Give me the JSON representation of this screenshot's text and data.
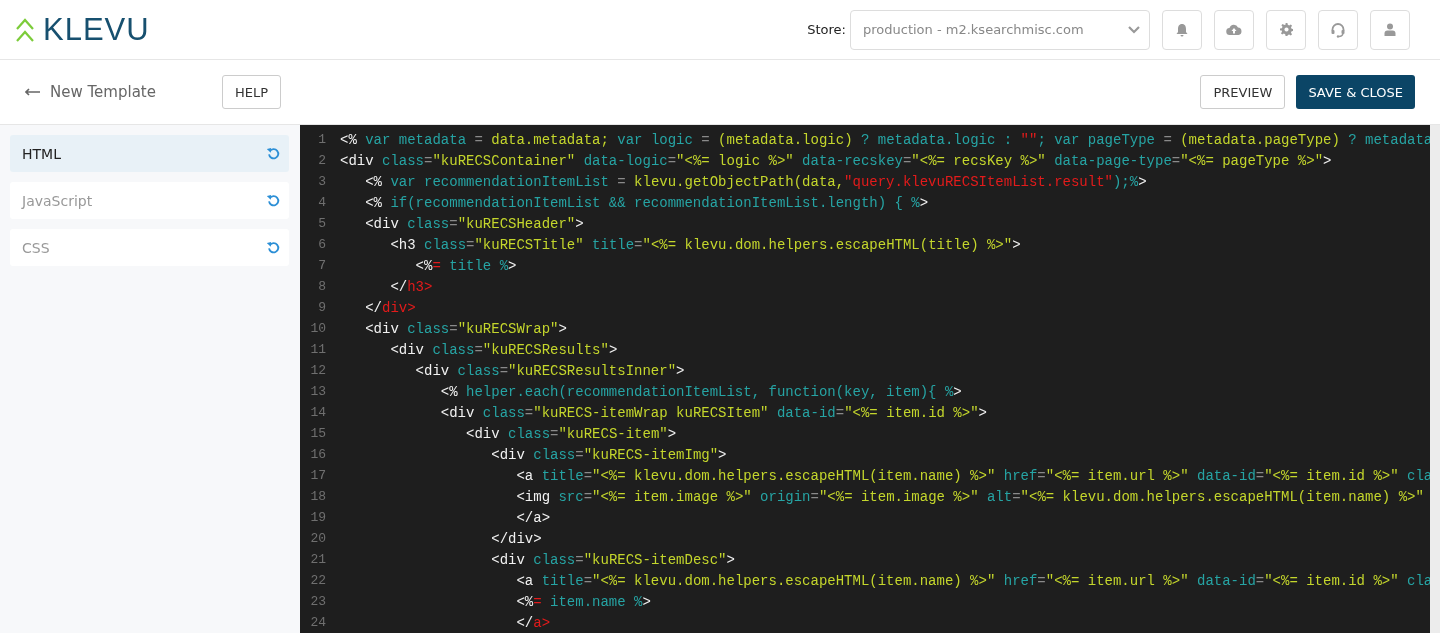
{
  "logo": {
    "text": "KLEVU"
  },
  "store": {
    "label": "Store:",
    "value": "production - m2.ksearchmisc.com"
  },
  "toolbar": {
    "back_label": "New Template",
    "help": "HELP",
    "preview": "PREVIEW",
    "save": "SAVE & CLOSE"
  },
  "sidebar": {
    "items": [
      {
        "label": "HTML",
        "selected": true
      },
      {
        "label": "JavaScript",
        "selected": false
      },
      {
        "label": "CSS",
        "selected": false
      }
    ]
  },
  "editor": {
    "lines": [
      {
        "number": "1",
        "tokens": [
          {
            "kind": "tag",
            "text": "<%"
          },
          {
            "kind": "attr",
            "text": " var metadata "
          },
          {
            "kind": "op",
            "text": "="
          },
          {
            "kind": "str",
            "text": " data.metadata;"
          },
          {
            "kind": "attr",
            "text": " var logic "
          },
          {
            "kind": "op",
            "text": "="
          },
          {
            "kind": "str",
            "text": " (metadata.logic)"
          },
          {
            "kind": "attr",
            "text": " ? metadata.logic : "
          },
          {
            "kind": "err",
            "text": "\"\""
          },
          {
            "kind": "attr",
            "text": "; var pageType "
          },
          {
            "kind": "op",
            "text": "="
          },
          {
            "kind": "str",
            "text": " (metadata.pageType)"
          },
          {
            "kind": "attr",
            "text": " ? metadata"
          }
        ]
      },
      {
        "number": "2",
        "tokens": [
          {
            "kind": "tag",
            "text": "<div"
          },
          {
            "kind": "attr",
            "text": " class"
          },
          {
            "kind": "op",
            "text": "="
          },
          {
            "kind": "str",
            "text": "\"kuRECSContainer\""
          },
          {
            "kind": "attr",
            "text": " data-logic"
          },
          {
            "kind": "op",
            "text": "="
          },
          {
            "kind": "str",
            "text": "\"<%= logic %>\""
          },
          {
            "kind": "attr",
            "text": " data-recskey"
          },
          {
            "kind": "op",
            "text": "="
          },
          {
            "kind": "str",
            "text": "\"<%= recsKey %>\""
          },
          {
            "kind": "attr",
            "text": " data-page-type"
          },
          {
            "kind": "op",
            "text": "="
          },
          {
            "kind": "str",
            "text": "\"<%= pageType %>\""
          },
          {
            "kind": "tag",
            "text": ">"
          }
        ]
      },
      {
        "number": "3",
        "tokens": [
          {
            "kind": "tag",
            "text": "   <%"
          },
          {
            "kind": "attr",
            "text": " var recommendationItemList "
          },
          {
            "kind": "op",
            "text": "="
          },
          {
            "kind": "str",
            "text": " klevu.getObjectPath(data,"
          },
          {
            "kind": "err",
            "text": "\"query.klevuRECSItemList.result\""
          },
          {
            "kind": "attr",
            "text": ");%"
          },
          {
            "kind": "tag",
            "text": ">"
          }
        ]
      },
      {
        "number": "4",
        "tokens": [
          {
            "kind": "tag",
            "text": "   <%"
          },
          {
            "kind": "attr",
            "text": " if(recommendationItemList && recommendationItemList.length) { %"
          },
          {
            "kind": "tag",
            "text": ">"
          }
        ]
      },
      {
        "number": "5",
        "tokens": [
          {
            "kind": "tag",
            "text": "   <div"
          },
          {
            "kind": "attr",
            "text": " class"
          },
          {
            "kind": "op",
            "text": "="
          },
          {
            "kind": "str",
            "text": "\"kuRECSHeader\""
          },
          {
            "kind": "tag",
            "text": ">"
          }
        ]
      },
      {
        "number": "6",
        "tokens": [
          {
            "kind": "tag",
            "text": "      <h3"
          },
          {
            "kind": "attr",
            "text": " class"
          },
          {
            "kind": "op",
            "text": "="
          },
          {
            "kind": "str",
            "text": "\"kuRECSTitle\""
          },
          {
            "kind": "attr",
            "text": " title"
          },
          {
            "kind": "op",
            "text": "="
          },
          {
            "kind": "str",
            "text": "\"<%= klevu.dom.helpers.escapeHTML(title) %>\""
          },
          {
            "kind": "tag",
            "text": ">"
          }
        ]
      },
      {
        "number": "7",
        "tokens": [
          {
            "kind": "tag",
            "text": "         <%"
          },
          {
            "kind": "err",
            "text": "="
          },
          {
            "kind": "attr",
            "text": " title %"
          },
          {
            "kind": "tag",
            "text": ">"
          }
        ]
      },
      {
        "number": "8",
        "tokens": [
          {
            "kind": "tag",
            "text": "      </"
          },
          {
            "kind": "err",
            "text": "h3>"
          }
        ]
      },
      {
        "number": "9",
        "tokens": [
          {
            "kind": "tag",
            "text": "   </"
          },
          {
            "kind": "err",
            "text": "div>"
          }
        ]
      },
      {
        "number": "10",
        "tokens": [
          {
            "kind": "tag",
            "text": "   <div"
          },
          {
            "kind": "attr",
            "text": " class"
          },
          {
            "kind": "op",
            "text": "="
          },
          {
            "kind": "str",
            "text": "\"kuRECSWrap\""
          },
          {
            "kind": "tag",
            "text": ">"
          }
        ]
      },
      {
        "number": "11",
        "tokens": [
          {
            "kind": "tag",
            "text": "      <div"
          },
          {
            "kind": "attr",
            "text": " class"
          },
          {
            "kind": "op",
            "text": "="
          },
          {
            "kind": "str",
            "text": "\"kuRECSResults\""
          },
          {
            "kind": "tag",
            "text": ">"
          }
        ]
      },
      {
        "number": "12",
        "tokens": [
          {
            "kind": "tag",
            "text": "         <div"
          },
          {
            "kind": "attr",
            "text": " class"
          },
          {
            "kind": "op",
            "text": "="
          },
          {
            "kind": "str",
            "text": "\"kuRECSResultsInner\""
          },
          {
            "kind": "tag",
            "text": ">"
          }
        ]
      },
      {
        "number": "13",
        "tokens": [
          {
            "kind": "tag",
            "text": "            <%"
          },
          {
            "kind": "attr",
            "text": " helper.each(recommendationItemList, function(key, item){ %"
          },
          {
            "kind": "tag",
            "text": ">"
          }
        ]
      },
      {
        "number": "14",
        "tokens": [
          {
            "kind": "tag",
            "text": "            <div"
          },
          {
            "kind": "attr",
            "text": " class"
          },
          {
            "kind": "op",
            "text": "="
          },
          {
            "kind": "str",
            "text": "\"kuRECS-itemWrap kuRECSItem\""
          },
          {
            "kind": "attr",
            "text": " data-id"
          },
          {
            "kind": "op",
            "text": "="
          },
          {
            "kind": "str",
            "text": "\"<%= item.id %>\""
          },
          {
            "kind": "tag",
            "text": ">"
          }
        ]
      },
      {
        "number": "15",
        "tokens": [
          {
            "kind": "tag",
            "text": "               <div"
          },
          {
            "kind": "attr",
            "text": " class"
          },
          {
            "kind": "op",
            "text": "="
          },
          {
            "kind": "str",
            "text": "\"kuRECS-item\""
          },
          {
            "kind": "tag",
            "text": ">"
          }
        ]
      },
      {
        "number": "16",
        "tokens": [
          {
            "kind": "tag",
            "text": "                  <div"
          },
          {
            "kind": "attr",
            "text": " class"
          },
          {
            "kind": "op",
            "text": "="
          },
          {
            "kind": "str",
            "text": "\"kuRECS-itemImg\""
          },
          {
            "kind": "tag",
            "text": ">"
          }
        ]
      },
      {
        "number": "17",
        "tokens": [
          {
            "kind": "tag",
            "text": "                     <a"
          },
          {
            "kind": "attr",
            "text": " title"
          },
          {
            "kind": "op",
            "text": "="
          },
          {
            "kind": "str",
            "text": "\"<%= klevu.dom.helpers.escapeHTML(item.name) %>\""
          },
          {
            "kind": "attr",
            "text": " href"
          },
          {
            "kind": "op",
            "text": "="
          },
          {
            "kind": "str",
            "text": "\"<%= item.url %>\""
          },
          {
            "kind": "attr",
            "text": " data-id"
          },
          {
            "kind": "op",
            "text": "="
          },
          {
            "kind": "str",
            "text": "\"<%= item.id %>\""
          },
          {
            "kind": "attr",
            "text": " cla"
          }
        ]
      },
      {
        "number": "18",
        "tokens": [
          {
            "kind": "tag",
            "text": "                     <img"
          },
          {
            "kind": "attr",
            "text": " src"
          },
          {
            "kind": "op",
            "text": "="
          },
          {
            "kind": "str",
            "text": "\"<%= item.image %>\""
          },
          {
            "kind": "attr",
            "text": " origin"
          },
          {
            "kind": "op",
            "text": "="
          },
          {
            "kind": "str",
            "text": "\"<%= item.image %>\""
          },
          {
            "kind": "attr",
            "text": " alt"
          },
          {
            "kind": "op",
            "text": "="
          },
          {
            "kind": "str",
            "text": "\"<%= klevu.dom.helpers.escapeHTML(item.name) %>\""
          }
        ]
      },
      {
        "number": "19",
        "tokens": [
          {
            "kind": "tag",
            "text": "                     </a>"
          }
        ]
      },
      {
        "number": "20",
        "tokens": [
          {
            "kind": "tag",
            "text": "                  </div>"
          }
        ]
      },
      {
        "number": "21",
        "tokens": [
          {
            "kind": "tag",
            "text": "                  <div"
          },
          {
            "kind": "attr",
            "text": " class"
          },
          {
            "kind": "op",
            "text": "="
          },
          {
            "kind": "str",
            "text": "\"kuRECS-itemDesc\""
          },
          {
            "kind": "tag",
            "text": ">"
          }
        ]
      },
      {
        "number": "22",
        "tokens": [
          {
            "kind": "tag",
            "text": "                     <a"
          },
          {
            "kind": "attr",
            "text": " title"
          },
          {
            "kind": "op",
            "text": "="
          },
          {
            "kind": "str",
            "text": "\"<%= klevu.dom.helpers.escapeHTML(item.name) %>\""
          },
          {
            "kind": "attr",
            "text": " href"
          },
          {
            "kind": "op",
            "text": "="
          },
          {
            "kind": "str",
            "text": "\"<%= item.url %>\""
          },
          {
            "kind": "attr",
            "text": " data-id"
          },
          {
            "kind": "op",
            "text": "="
          },
          {
            "kind": "str",
            "text": "\"<%= item.id %>\""
          },
          {
            "kind": "attr",
            "text": " cla"
          }
        ]
      },
      {
        "number": "23",
        "tokens": [
          {
            "kind": "tag",
            "text": "                     <%"
          },
          {
            "kind": "err",
            "text": "="
          },
          {
            "kind": "attr",
            "text": " item.name %"
          },
          {
            "kind": "tag",
            "text": ">"
          }
        ]
      },
      {
        "number": "24",
        "tokens": [
          {
            "kind": "tag",
            "text": "                     </"
          },
          {
            "kind": "err",
            "text": "a>"
          }
        ]
      }
    ]
  }
}
